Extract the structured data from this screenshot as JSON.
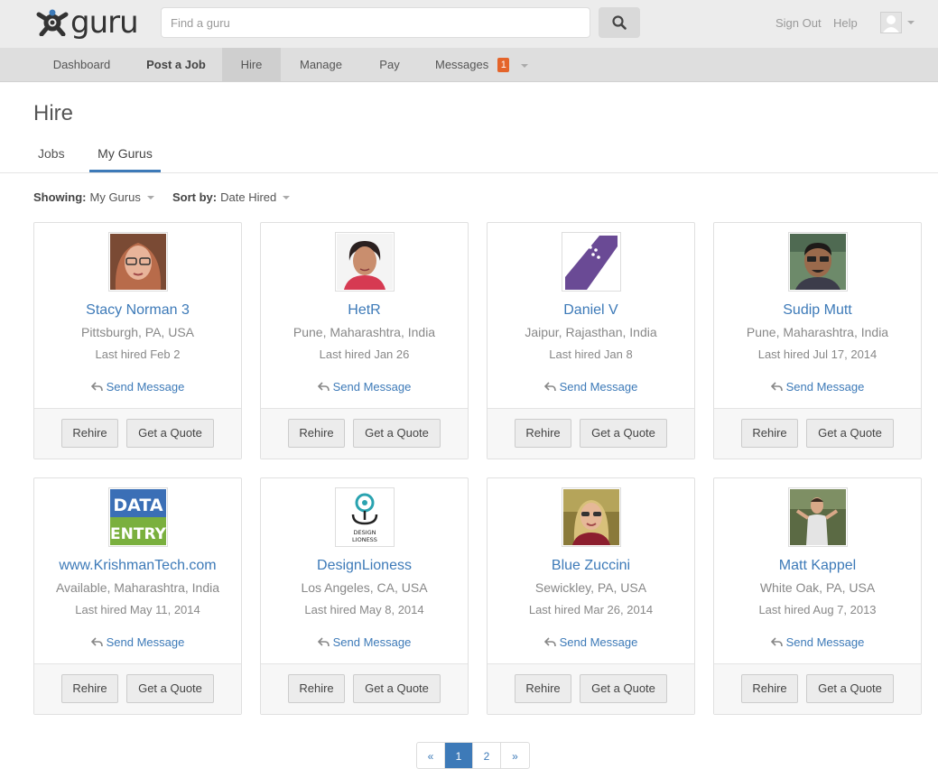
{
  "brand": {
    "name": "guru"
  },
  "search": {
    "placeholder": "Find a guru"
  },
  "top_links": {
    "sign_out": "Sign Out",
    "help": "Help"
  },
  "nav": {
    "dashboard": "Dashboard",
    "post_job": "Post a Job",
    "hire": "Hire",
    "manage": "Manage",
    "pay": "Pay",
    "messages": "Messages",
    "messages_count": "1"
  },
  "page": {
    "title": "Hire"
  },
  "tabs": {
    "jobs": "Jobs",
    "my_gurus": "My Gurus"
  },
  "filters": {
    "showing_label": "Showing:",
    "showing_value": "My Gurus",
    "sort_label": "Sort by:",
    "sort_value": "Date Hired"
  },
  "card_actions": {
    "send_message": "Send Message",
    "rehire": "Rehire",
    "get_quote": "Get a Quote"
  },
  "gurus": [
    {
      "name": "Stacy Norman 3",
      "location": "Pittsburgh, PA, USA",
      "last_hired": "Last hired Feb 2"
    },
    {
      "name": "HetR",
      "location": "Pune, Maharashtra, India",
      "last_hired": "Last hired Jan 26"
    },
    {
      "name": "Daniel V",
      "location": "Jaipur, Rajasthan, India",
      "last_hired": "Last hired Jan 8"
    },
    {
      "name": "Sudip Mutt",
      "location": "Pune, Maharashtra, India",
      "last_hired": "Last hired Jul 17, 2014"
    },
    {
      "name": "www.KrishmanTech.com",
      "location": "Available, Maharashtra, India",
      "last_hired": "Last hired May 11, 2014",
      "logo_line1": "DATA",
      "logo_line2": "ENTRY"
    },
    {
      "name": "DesignLioness",
      "location": "Los Angeles, CA, USA",
      "last_hired": "Last hired May 8, 2014",
      "logo_line1": "DESIGN",
      "logo_line2": "LIONESS"
    },
    {
      "name": "Blue Zuccini",
      "location": "Sewickley, PA, USA",
      "last_hired": "Last hired Mar 26, 2014"
    },
    {
      "name": "Matt Kappel",
      "location": "White Oak, PA, USA",
      "last_hired": "Last hired Aug 7, 2013"
    }
  ],
  "pagination": {
    "prev": "«",
    "pages": [
      "1",
      "2"
    ],
    "next": "»",
    "current": "1"
  },
  "colors": {
    "link": "#3d7ab8",
    "badge": "#e4642a",
    "topbar": "#ececec",
    "nav": "#dedede"
  }
}
